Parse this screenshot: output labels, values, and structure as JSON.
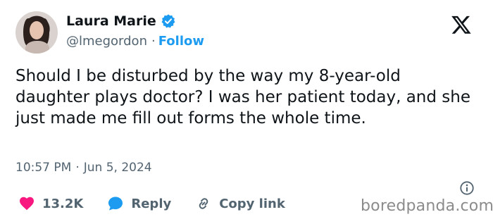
{
  "author": {
    "name": "Laura Marie",
    "handle": "@lmegordon",
    "separator": "·",
    "follow_label": "Follow"
  },
  "tweet": {
    "text": "Should I be disturbed by the way my 8-year-old daughter plays doctor? I was her patient today, and she just made me fill out forms the whole time.",
    "time": "10:57 PM",
    "date_separator": "·",
    "date": "Jun 5, 2024"
  },
  "actions": {
    "likes_count": "13.2K",
    "reply_label": "Reply",
    "copy_link_label": "Copy link"
  },
  "watermark": "boredpanda.com",
  "colors": {
    "accent": "#1d9bf0",
    "like": "#f91880",
    "text": "#0f1419",
    "muted": "#536471"
  },
  "icons": [
    "verified-badge-icon",
    "x-logo-icon",
    "info-icon",
    "heart-icon",
    "reply-bubble-icon",
    "link-icon"
  ]
}
